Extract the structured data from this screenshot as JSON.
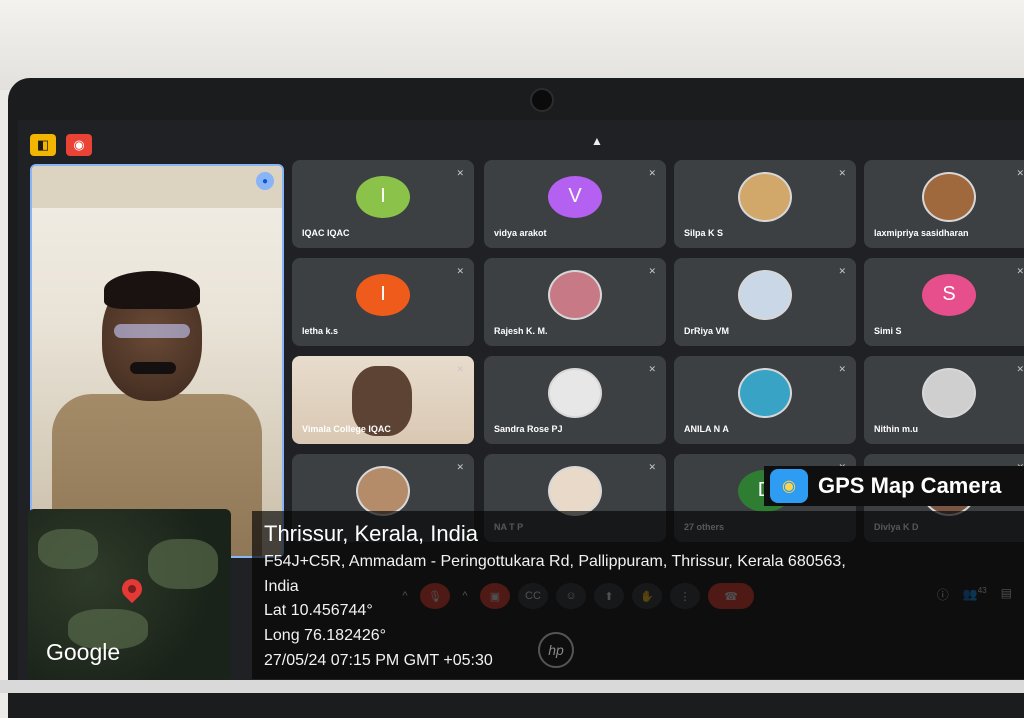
{
  "top_badges": [
    {
      "icon": "camera-off-icon",
      "color": "#f3b600"
    },
    {
      "icon": "record-icon",
      "color": "#ea4335"
    }
  ],
  "tiles": [
    {
      "name": "IQAC IQAC",
      "type": "letter",
      "letter": "I",
      "color": "#8bc34a"
    },
    {
      "name": "vidya arakot",
      "type": "letter",
      "letter": "V",
      "color": "#b461f2"
    },
    {
      "name": "Silpa K S",
      "type": "photo",
      "color": "#d2a86a"
    },
    {
      "name": "laxmipriya sasidharan",
      "type": "photo",
      "color": "#a0683d"
    },
    {
      "name": "letha k.s",
      "type": "letter",
      "letter": "I",
      "color": "#ef5b1a"
    },
    {
      "name": "Rajesh K. M.",
      "type": "photo",
      "color": "#c77a86"
    },
    {
      "name": "DrRiya VM",
      "type": "photo",
      "color": "#c9d7e6"
    },
    {
      "name": "Simi S",
      "type": "letter",
      "letter": "S",
      "color": "#e74f8c"
    },
    {
      "name": "Vimala College IQAC",
      "type": "video",
      "color": "#d9c8b3"
    },
    {
      "name": "Sandra Rose PJ",
      "type": "photo",
      "color": "#e7e7e7"
    },
    {
      "name": "ANILA N A",
      "type": "photo",
      "color": "#38a3c4"
    },
    {
      "name": "Nithin m.u",
      "type": "photo",
      "color": "#cfcfcf"
    },
    {
      "name": "",
      "type": "photo",
      "color": "#b58c6a"
    },
    {
      "name": "NA T P",
      "type": "photo",
      "color": "#e8d9c8"
    },
    {
      "name": "27 others",
      "type": "group",
      "letter": "D",
      "color": "#2e7d32"
    },
    {
      "name": "Divlya K D",
      "type": "photo",
      "color": "#7a5644"
    }
  ],
  "controls": [
    "mic-off-icon",
    "camera-off-icon",
    "captions-icon",
    "emoji-icon",
    "present-icon",
    "hand-icon",
    "more-icon",
    "end-call-icon"
  ],
  "right_controls": [
    "info-icon",
    "people-icon",
    "chat-icon"
  ],
  "participant_count": "43",
  "overlay": {
    "title": "Thrissur, Kerala, India",
    "address_line1": "F54J+C5R, Ammadam - Peringottukara Rd, Pallippuram, Thrissur, Kerala 680563,",
    "address_line2": "India",
    "lat": "Lat 10.456744°",
    "long": "Long 76.182426°",
    "datetime": "27/05/24 07:15 PM GMT +05:30"
  },
  "map": {
    "label": "Google"
  },
  "gps_camera": {
    "label": "GPS Map Camera"
  },
  "hp_logo": "hp"
}
